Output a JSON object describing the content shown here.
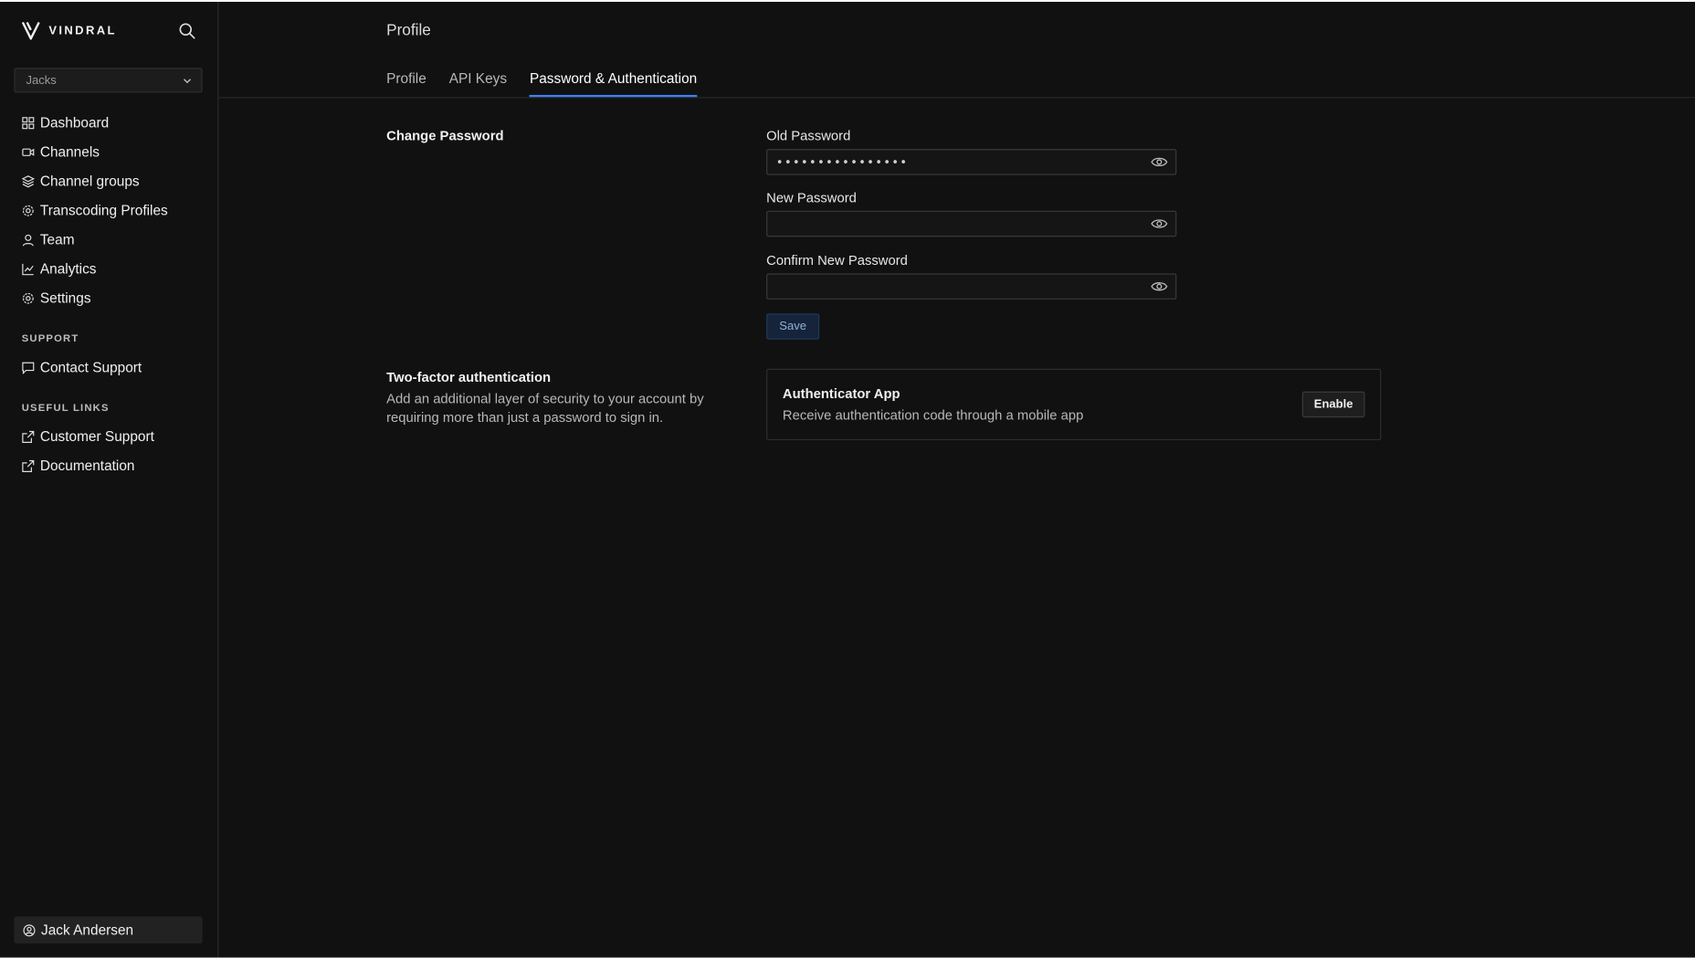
{
  "brand": {
    "name": "VINDRAL"
  },
  "org_select": {
    "value": "Jacks"
  },
  "nav": {
    "main": [
      {
        "label": "Dashboard",
        "icon": "dashboard-icon"
      },
      {
        "label": "Channels",
        "icon": "video-icon"
      },
      {
        "label": "Channel groups",
        "icon": "layers-icon"
      },
      {
        "label": "Transcoding Profiles",
        "icon": "gear-icon"
      },
      {
        "label": "Team",
        "icon": "user-icon"
      },
      {
        "label": "Analytics",
        "icon": "chart-icon"
      },
      {
        "label": "Settings",
        "icon": "gear-icon"
      }
    ],
    "support_label": "SUPPORT",
    "support": [
      {
        "label": "Contact Support",
        "icon": "chat-icon"
      }
    ],
    "links_label": "USEFUL LINKS",
    "links": [
      {
        "label": "Customer Support",
        "icon": "external-link-icon"
      },
      {
        "label": "Documentation",
        "icon": "external-link-icon"
      }
    ]
  },
  "user": {
    "name": "Jack Andersen"
  },
  "page": {
    "title": "Profile",
    "tabs": [
      {
        "label": "Profile",
        "active": false
      },
      {
        "label": "API Keys",
        "active": false
      },
      {
        "label": "Password & Authentication",
        "active": true
      }
    ]
  },
  "change_password": {
    "title": "Change Password",
    "old_label": "Old Password",
    "old_value": "••••••••••••••••",
    "new_label": "New Password",
    "new_value": "",
    "confirm_label": "Confirm New Password",
    "confirm_value": "",
    "save_label": "Save"
  },
  "two_factor": {
    "title": "Two-factor authentication",
    "description": "Add an additional layer of security to your account by requiring more than just a password to sign in.",
    "card_title": "Authenticator App",
    "card_description": "Receive authentication code through a mobile app",
    "enable_label": "Enable"
  },
  "colors": {
    "background": "#111111",
    "accent": "#3b82f6",
    "save_button": "#15243a"
  }
}
